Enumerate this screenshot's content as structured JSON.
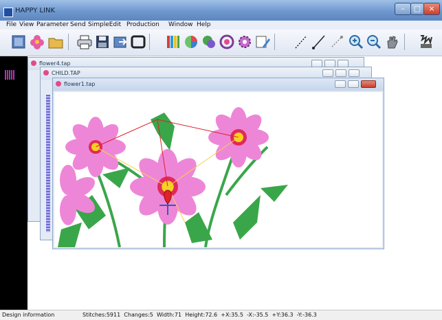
{
  "window": {
    "title": "HAPPY LINK"
  },
  "menu": [
    "File",
    "View",
    "Parameter",
    "Send",
    "SimpleEdit",
    "Production",
    "Window",
    "Help"
  ],
  "toolbar_icons": [
    "design-icon",
    "flower-icon",
    "folder-open-icon",
    "print-icon",
    "save-icon",
    "export-icon",
    "frame-icon",
    "thread-color-icon",
    "color-wheel-icon",
    "fill-icon",
    "hoop-icon",
    "settings-gear-icon",
    "edit-icon",
    "line-icon",
    "line-angle-icon",
    "measure-icon",
    "zoom-in-icon",
    "zoom-out-icon",
    "hand-pan-icon",
    "send-to-machine-icon"
  ],
  "documents": [
    {
      "title": "flower4.tap"
    },
    {
      "title": "CHILD.TAP"
    },
    {
      "title": "flower1.tap"
    }
  ],
  "status": {
    "label": "Design information",
    "stitches": "Stitches:5911",
    "changes": "Changes:5",
    "width": "Width:71",
    "height": "Height:72.6",
    "plus_x": "+X:35.5",
    "minus_x": "-X:-35.5",
    "plus_y": "+Y:36.3",
    "minus_y": "-Y:-36.3"
  },
  "colors": {
    "titlebar": "#6f98cf",
    "petal": "#ee86d8",
    "leaf": "#3aa64a",
    "center": "#f5d020",
    "stitch_line": "#e0202a",
    "close_button": "#d04030"
  }
}
